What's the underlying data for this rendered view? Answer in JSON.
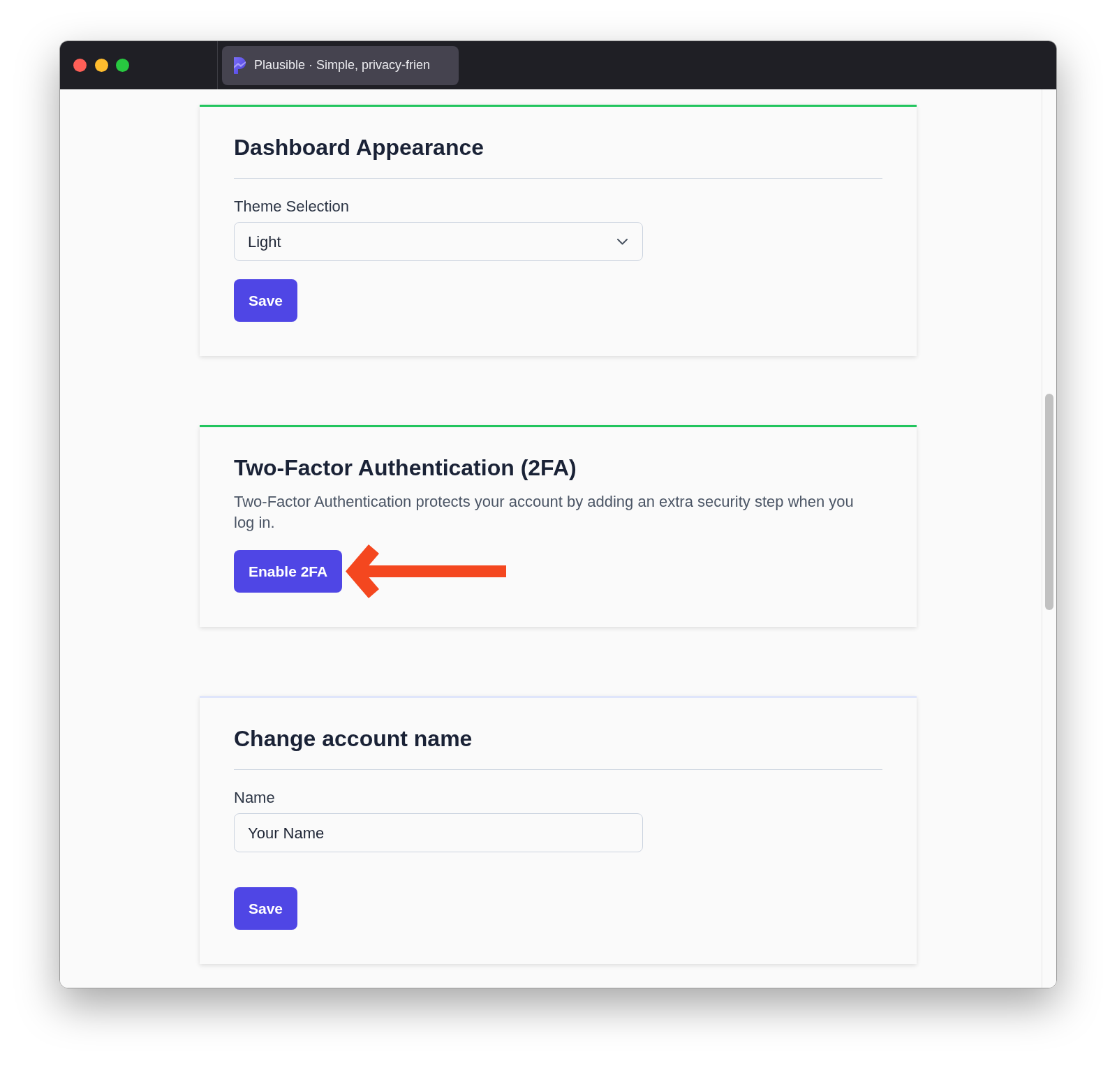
{
  "window": {
    "tabs": [
      {
        "title": "Plausible · Simple, privacy-frien",
        "selected": true
      }
    ]
  },
  "sections": [
    {
      "kind": "form",
      "title": "Dashboard Appearance",
      "color": "#22c55e",
      "field": {
        "kind": "select",
        "label": "Theme Selection",
        "value": "Light"
      },
      "button": "Save"
    },
    {
      "kind": "info",
      "title": "Two-Factor Authentication (2FA)",
      "color": "#22c55e",
      "description": "Two-Factor Authentication protects your account by adding an extra security step when you log in.",
      "button": "Enable 2FA",
      "pointer_arrow": true
    },
    {
      "kind": "form",
      "title": "Change account name",
      "color": "#dfe5fb",
      "field": {
        "kind": "text",
        "label": "Name",
        "value": "Your Name"
      },
      "button": "Save"
    }
  ]
}
